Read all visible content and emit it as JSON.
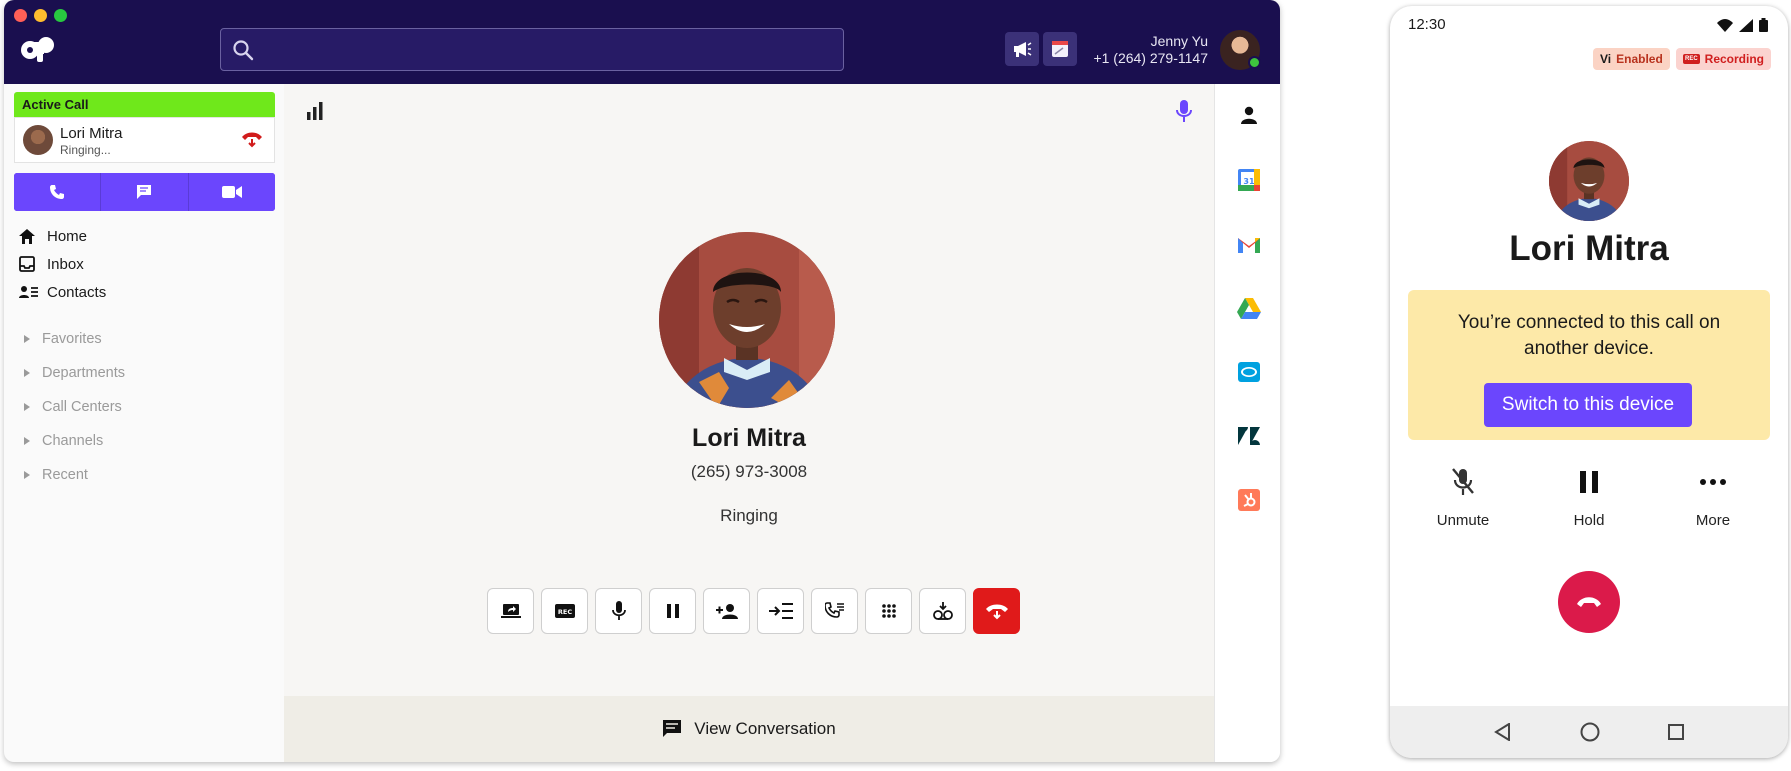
{
  "header": {
    "search_placeholder": "",
    "user_name": "Jenny Yu",
    "user_phone": "+1 (264) 279-1147"
  },
  "sidebar": {
    "active_call_label": "Active Call",
    "active_call": {
      "name": "Lori Mitra",
      "status": "Ringing..."
    },
    "nav": [
      {
        "label": "Home",
        "icon": "home-icon"
      },
      {
        "label": "Inbox",
        "icon": "inbox-icon"
      },
      {
        "label": "Contacts",
        "icon": "contacts-icon"
      }
    ],
    "groups": [
      "Favorites",
      "Departments",
      "Call Centers",
      "Channels",
      "Recent"
    ]
  },
  "call": {
    "name": "Lori Mitra",
    "phone": "(265) 973-3008",
    "status": "Ringing",
    "view_conversation": "View Conversation",
    "controls": [
      "share-screen-icon",
      "record-icon",
      "mic-icon",
      "hold-icon",
      "add-person-icon",
      "transfer-icon",
      "call-list-icon",
      "keypad-icon",
      "voicemail-icon",
      "hangup-icon"
    ]
  },
  "rail": [
    "contact-icon",
    "google-calendar-icon",
    "gmail-icon",
    "google-drive-icon",
    "salesforce-icon",
    "zendesk-icon",
    "hubspot-icon"
  ],
  "phone": {
    "time": "12:30",
    "vi_badge": "Vi",
    "enabled_label": "Enabled",
    "rec_badge": "REC",
    "recording_label": "Recording",
    "name": "Lori Mitra",
    "banner_text": "You’re connected to this call on another device.",
    "switch_label": "Switch to this device",
    "controls": [
      {
        "label": "Unmute",
        "icon": "mic-off-icon"
      },
      {
        "label": "Hold",
        "icon": "pause-icon"
      },
      {
        "label": "More",
        "icon": "more-icon"
      }
    ]
  },
  "colors": {
    "topbar": "#1a0f4f",
    "accent": "#6b46fd",
    "active_call": "#6fe81b",
    "hangup": "#e01a1a",
    "banner": "#fde9a8"
  }
}
